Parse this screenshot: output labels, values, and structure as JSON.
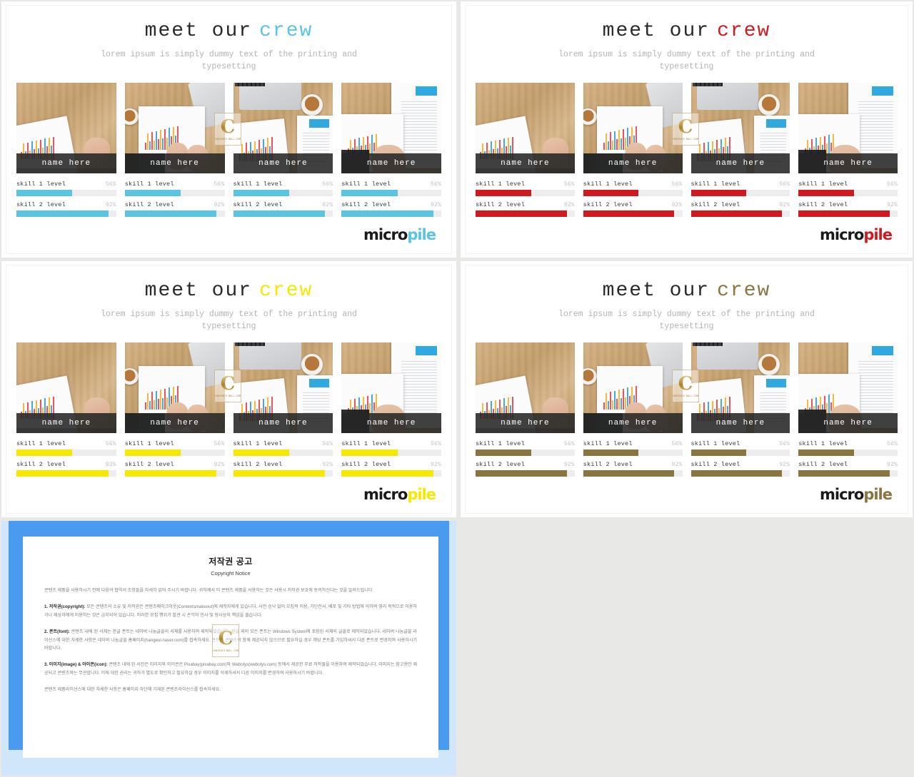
{
  "slides": [
    {
      "id": "slide-blue",
      "title_main": "meet our",
      "title_accent": "crew",
      "accent_color": "#5bc4e0",
      "subtitle": "lorem ipsum is simply dummy text of the printing and typesetting",
      "logo_dark": "micro",
      "logo_accent": "pile",
      "cards": [
        {
          "name": "name here",
          "skills": [
            {
              "label": "skill 1 level",
              "pct_label": "56%",
              "pct": 56
            },
            {
              "label": "skill 2 level",
              "pct_label": "92%",
              "pct": 92
            }
          ]
        },
        {
          "name": "name here",
          "skills": [
            {
              "label": "skill 1 level",
              "pct_label": "56%",
              "pct": 56
            },
            {
              "label": "skill 2 level",
              "pct_label": "92%",
              "pct": 92
            }
          ]
        },
        {
          "name": "name here",
          "skills": [
            {
              "label": "skill 1 level",
              "pct_label": "56%",
              "pct": 56
            },
            {
              "label": "skill 2 level",
              "pct_label": "92%",
              "pct": 92
            }
          ]
        },
        {
          "name": "name here",
          "skills": [
            {
              "label": "skill 1 level",
              "pct_label": "56%",
              "pct": 56
            },
            {
              "label": "skill 2 level",
              "pct_label": "92%",
              "pct": 92
            }
          ]
        }
      ]
    },
    {
      "id": "slide-red",
      "title_main": "meet our",
      "title_accent": "crew",
      "accent_color": "#cf1a20",
      "subtitle": "lorem ipsum is simply dummy text of the printing and typesetting",
      "logo_dark": "micro",
      "logo_accent": "pile",
      "cards": [
        {
          "name": "name here",
          "skills": [
            {
              "label": "skill 1 level",
              "pct_label": "56%",
              "pct": 56
            },
            {
              "label": "skill 2 level",
              "pct_label": "92%",
              "pct": 92
            }
          ]
        },
        {
          "name": "name here",
          "skills": [
            {
              "label": "skill 1 level",
              "pct_label": "56%",
              "pct": 56
            },
            {
              "label": "skill 2 level",
              "pct_label": "92%",
              "pct": 92
            }
          ]
        },
        {
          "name": "name here",
          "skills": [
            {
              "label": "skill 1 level",
              "pct_label": "56%",
              "pct": 56
            },
            {
              "label": "skill 2 level",
              "pct_label": "92%",
              "pct": 92
            }
          ]
        },
        {
          "name": "name here",
          "skills": [
            {
              "label": "skill 1 level",
              "pct_label": "56%",
              "pct": 56
            },
            {
              "label": "skill 2 level",
              "pct_label": "92%",
              "pct": 92
            }
          ]
        }
      ]
    },
    {
      "id": "slide-yellow",
      "title_main": "meet our",
      "title_accent": "crew",
      "accent_color": "#f6e800",
      "subtitle": "lorem ipsum is simply dummy text of the printing and typesetting",
      "logo_dark": "micro",
      "logo_accent": "pile",
      "cards": [
        {
          "name": "name here",
          "skills": [
            {
              "label": "skill 1 level",
              "pct_label": "56%",
              "pct": 56
            },
            {
              "label": "skill 2 level",
              "pct_label": "92%",
              "pct": 92
            }
          ]
        },
        {
          "name": "name here",
          "skills": [
            {
              "label": "skill 1 level",
              "pct_label": "56%",
              "pct": 56
            },
            {
              "label": "skill 2 level",
              "pct_label": "92%",
              "pct": 92
            }
          ]
        },
        {
          "name": "name here",
          "skills": [
            {
              "label": "skill 1 level",
              "pct_label": "56%",
              "pct": 56
            },
            {
              "label": "skill 2 level",
              "pct_label": "92%",
              "pct": 92
            }
          ]
        },
        {
          "name": "name here",
          "skills": [
            {
              "label": "skill 1 level",
              "pct_label": "56%",
              "pct": 56
            },
            {
              "label": "skill 2 level",
              "pct_label": "92%",
              "pct": 92
            }
          ]
        }
      ]
    },
    {
      "id": "slide-brown",
      "title_main": "meet our",
      "title_accent": "crew",
      "accent_color": "#8a7440",
      "subtitle": "lorem ipsum is simply dummy text of the printing and typesetting",
      "logo_dark": "micro",
      "logo_accent": "pile",
      "cards": [
        {
          "name": "name here",
          "skills": [
            {
              "label": "skill 1 level",
              "pct_label": "56%",
              "pct": 56
            },
            {
              "label": "skill 2 level",
              "pct_label": "92%",
              "pct": 92
            }
          ]
        },
        {
          "name": "name here",
          "skills": [
            {
              "label": "skill 1 level",
              "pct_label": "56%",
              "pct": 56
            },
            {
              "label": "skill 2 level",
              "pct_label": "92%",
              "pct": 92
            }
          ]
        },
        {
          "name": "name here",
          "skills": [
            {
              "label": "skill 1 level",
              "pct_label": "56%",
              "pct": 56
            },
            {
              "label": "skill 2 level",
              "pct_label": "92%",
              "pct": 92
            }
          ]
        },
        {
          "name": "name here",
          "skills": [
            {
              "label": "skill 1 level",
              "pct_label": "56%",
              "pct": 56
            },
            {
              "label": "skill 2 level",
              "pct_label": "92%",
              "pct": 92
            }
          ]
        }
      ]
    }
  ],
  "watermark": {
    "letter": "C",
    "caption": "CONTENTS  MALL.COM"
  },
  "copyright": {
    "title_ko": "저작권 공고",
    "title_en": "Copyright Notice",
    "intro": "콘텐츠 제품을 사용하시기 전에 다음의 협약서 조항들을 자세히 읽어 주시기 바랍니다. 귀하께서 이 콘텐츠 제품을 사용하는 것은 사용시 저작권 보호에 동의하신다는 것을 알려드립니다.",
    "sections": [
      {
        "heading": "1. 저작권(copyright):",
        "body": " 모든 콘텐츠의 소유 및 저작권은 콘텐츠메이크아웃(Contentsmakeout)에 제작자에게 있습니다. 사전 승낙 없이 모집적 이용, 가단전사, 배포 및 기타 방법에 의하여 영리 목적으로 이용하거나 제삼자에게 이용하는 것은 금지되어 있습니다. 이러한 모집 행위가 발견 시 손익의 민사 및 형사상의 책임을 물습니다."
      },
      {
        "heading": "2. 폰트(font):",
        "body": " 콘텐츠 내에 된 서체는 한글 폰트는 네이버 나눔글꼴의 서체를 사용하여 제작되었습니다. 한글 외의 모든 폰트는 Windows System에 포함된 서체의 글꼴로 제작되었습니다. 네이버 나눔글꼴 라이선스에 대한 자세한 사항은 네이버 나눔글꼴 홈페이지(hangeul.naver.com)를 접속하세요. 폰트는 콘텐츠의 함께 제공되지 않으므로 필요하실 경우 해당 폰트를 가입하셔서 다른 폰트로 변경하여 사용하시기 바랍니다."
      },
      {
        "heading": "3. 이미지(image) & 아이콘(icon):",
        "body": " 콘텐츠 내에 된 사진은 이미지와 아이콘은 Pixabay(pixabay.com)와 Webolys(webolys.com) 등에서 제공한 무료 저작물을 이용하여 제작되었습니다. 이미지는 참고용만 제공되고 콘텐츠와는 무관합니다. 이에 대한 권리는 귀하가 별도로 확인하고 필요하실 경우 이미지를 삭제하셔서 다른 이미지를 변경하여 사용하시기 바랍니다."
      }
    ],
    "footer": "콘텐츠 제품라이선스에 대한 자세한 사항은 홈페이지 하단에 기재된 콘텐츠라이선스를 접속하세요."
  }
}
